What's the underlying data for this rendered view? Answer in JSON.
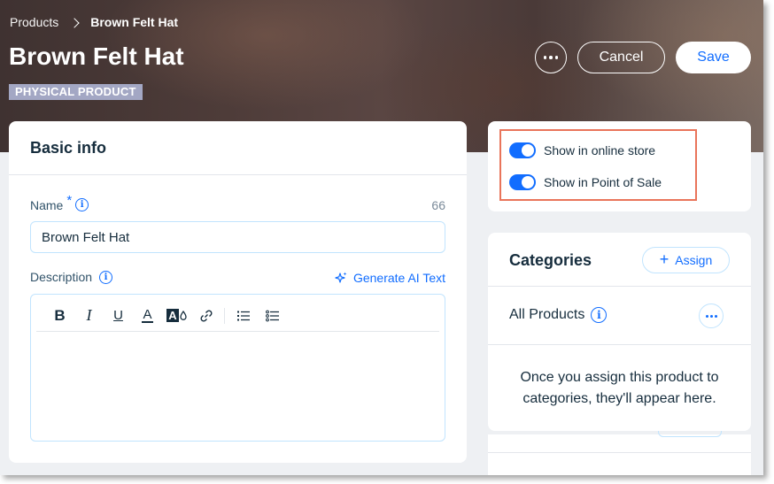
{
  "breadcrumb": {
    "root": "Products",
    "current": "Brown Felt Hat"
  },
  "header": {
    "title": "Brown Felt Hat",
    "badge": "PHYSICAL PRODUCT",
    "cancel_label": "Cancel",
    "save_label": "Save"
  },
  "basic_info": {
    "title": "Basic info",
    "name_label": "Name",
    "name_required_mark": "*",
    "name_char_count": "66",
    "name_value": "Brown Felt Hat",
    "description_label": "Description",
    "generate_ai_label": "Generate AI Text",
    "toolbar": {
      "bold": "B",
      "italic": "I",
      "underline": "U",
      "text_color": "A",
      "highlight": "A"
    }
  },
  "visibility": {
    "online_store_label": "Show in online store",
    "online_store_on": true,
    "pos_label": "Show in Point of Sale",
    "pos_on": true
  },
  "categories": {
    "title": "Categories",
    "assign_label": "Assign",
    "item_label": "All Products",
    "empty_message": "Once you assign this product to categories, they'll appear here."
  },
  "colors": {
    "accent": "#116dff",
    "highlight_border": "#e9745a",
    "badge_bg": "#a3a7c4",
    "text_primary": "#162d3d"
  },
  "icons": {
    "more": "more-horizontal-icon",
    "chevron": "chevron-right-icon",
    "info": "info-icon",
    "ai": "sparkle-icon",
    "link": "link-icon",
    "bullet_list": "bulleted-list-icon",
    "numbered_list": "numbered-list-icon",
    "plus": "plus-icon"
  }
}
